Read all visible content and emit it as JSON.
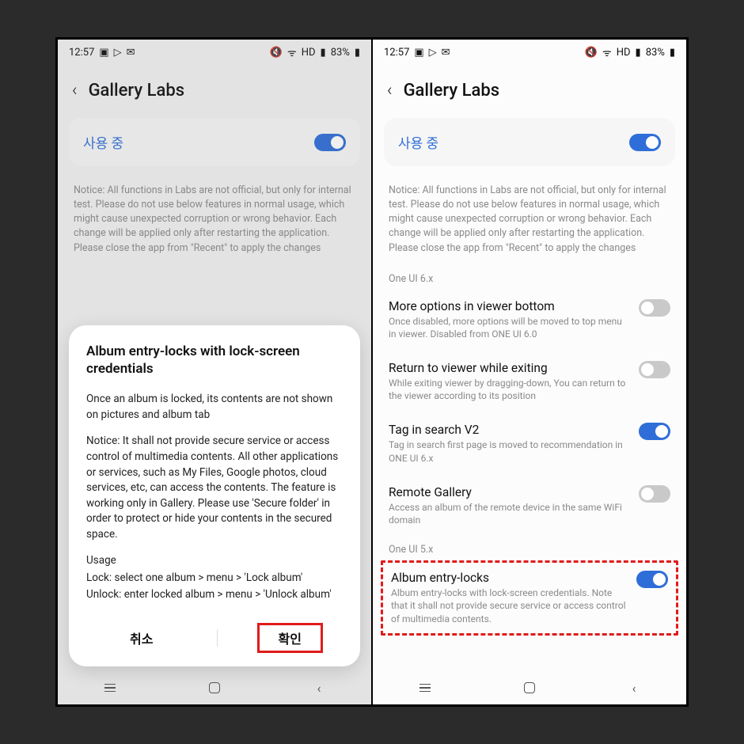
{
  "status": {
    "time": "12:57",
    "battery": "83%",
    "net_label": "HD",
    "icons_left": [
      "image-icon",
      "play-icon",
      "chat-icon"
    ],
    "icons_right": [
      "mute-icon",
      "wifi-icon",
      "hd-icon",
      "signal-icon",
      "battery-icon"
    ]
  },
  "header": {
    "title": "Gallery Labs"
  },
  "inuse": {
    "label": "사용 중",
    "toggle_on": true
  },
  "notice": "Notice: All functions in Labs are not official, but only for internal test. Please do not use below features in normal usage, which might cause unexpected corruption or wrong behavior. Each change will be applied only after restarting the application. Please close the app from \"Recent\" to apply the changes",
  "sections": {
    "oneui6": "One UI 6.x",
    "oneui5": "One UI 5.x"
  },
  "settings": [
    {
      "title": "More options in viewer bottom",
      "sub": "Once disabled, more options will be moved to top menu in viewer. Disabled from ONE UI 6.0",
      "on": false
    },
    {
      "title": "Return to viewer while exiting",
      "sub": "While exiting viewer by dragging-down, You can return to the viewer according to its position",
      "on": false
    },
    {
      "title": "Tag in search V2",
      "sub": "Tag in search first page is moved to recommendation in ONE UI 6.x",
      "on": true
    },
    {
      "title": "Remote Gallery",
      "sub": "Access an album of the remote device in the same WiFi domain",
      "on": false
    }
  ],
  "highlighted": {
    "title": "Album entry-locks",
    "sub": "Album entry-locks with lock-screen credentials. Note that it shall not provide secure service or access control of multimedia contents.",
    "on": true
  },
  "dialog": {
    "title": "Album entry-locks with lock-screen credentials",
    "p1": "Once an album is locked, its contents are not shown on pictures and album tab",
    "p2": "Notice: It shall not provide secure service or access control of multimedia contents. All other applications or services, such as My Files, Google photos, cloud services, etc, can access the contents. The feature is working only in Gallery. Please use 'Secure folder' in order to protect or hide your contents in the secured space.",
    "usage_label": "Usage",
    "usage_lock": "Lock: select one album > menu > 'Lock album'",
    "usage_unlock": "Unlock: enter locked album > menu > 'Unlock album'",
    "cancel": "취소",
    "confirm": "확인"
  }
}
